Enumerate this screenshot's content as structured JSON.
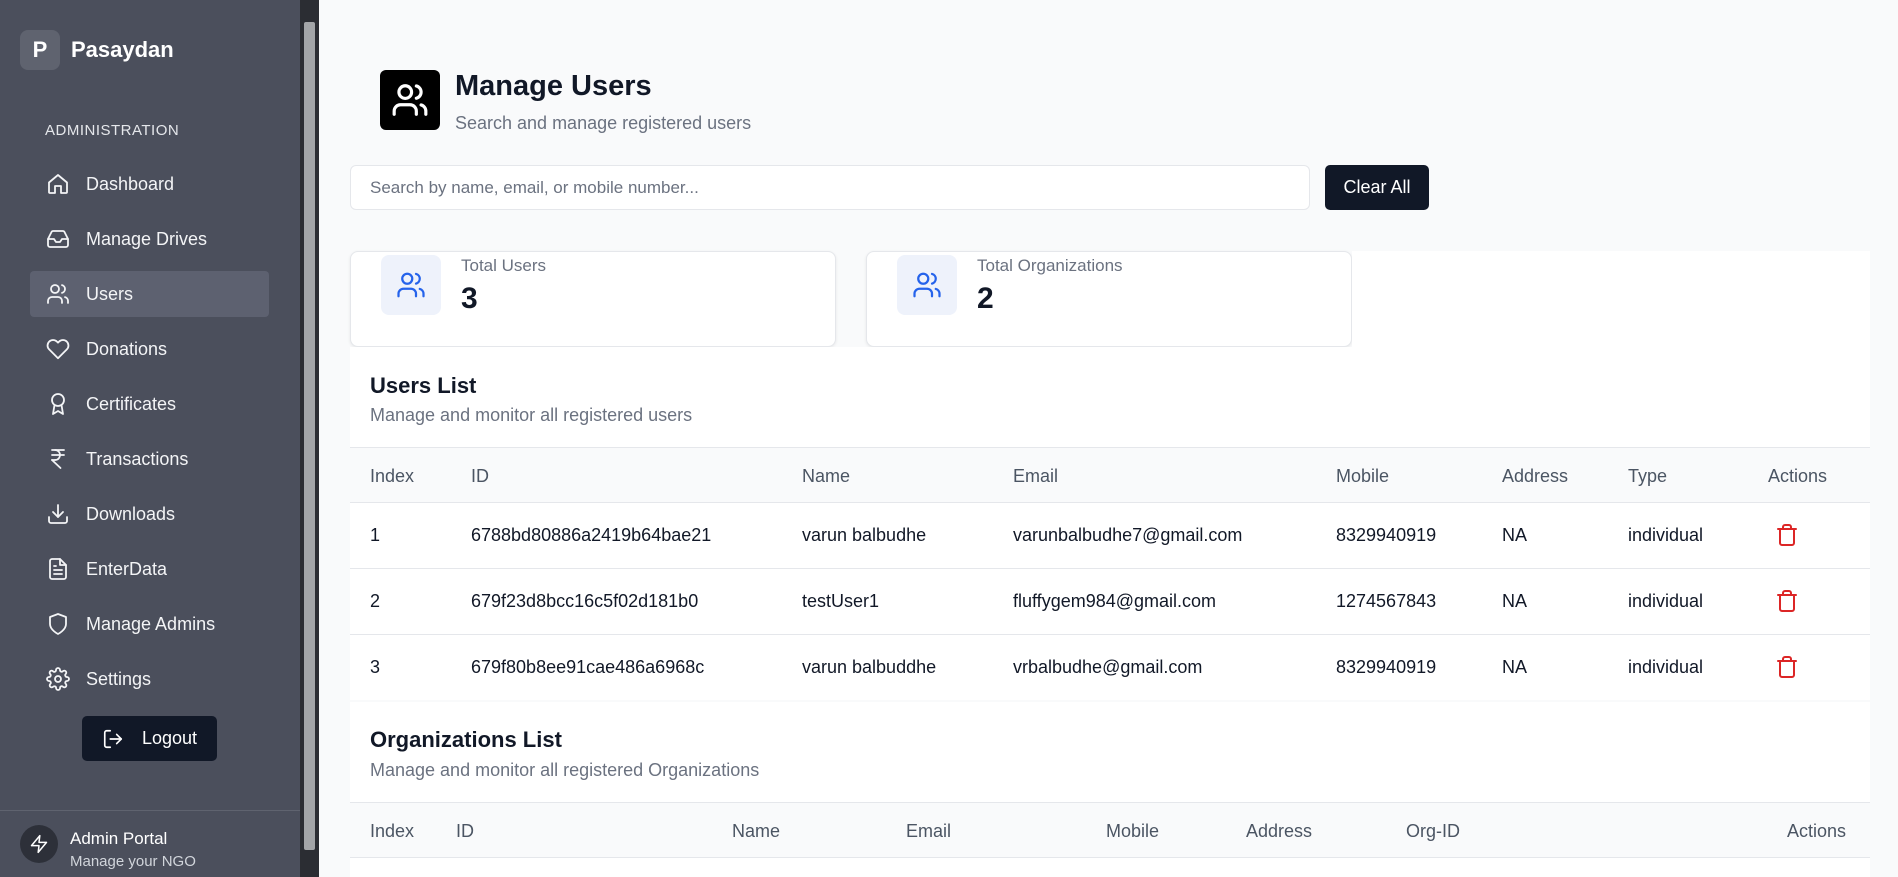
{
  "brand": {
    "logo_letter": "P",
    "name": "Pasaydan"
  },
  "sidebar": {
    "section_label": "ADMINISTRATION",
    "items": [
      {
        "label": "Dashboard",
        "icon": "home-icon"
      },
      {
        "label": "Manage Drives",
        "icon": "inbox-icon"
      },
      {
        "label": "Users",
        "icon": "users-icon",
        "active": true
      },
      {
        "label": "Donations",
        "icon": "heart-icon"
      },
      {
        "label": "Certificates",
        "icon": "award-icon"
      },
      {
        "label": "Transactions",
        "icon": "rupee-icon"
      },
      {
        "label": "Downloads",
        "icon": "download-icon"
      },
      {
        "label": "EnterData",
        "icon": "file-text-icon"
      },
      {
        "label": "Manage Admins",
        "icon": "shield-icon"
      },
      {
        "label": "Settings",
        "icon": "gear-icon"
      }
    ],
    "logout_label": "Logout",
    "footer": {
      "title": "Admin Portal",
      "subtitle": "Manage your NGO"
    }
  },
  "header": {
    "title": "Manage Users",
    "subtitle": "Search and manage registered users"
  },
  "search": {
    "placeholder": "Search by name, email, or mobile number...",
    "value": "",
    "clear_label": "Clear All"
  },
  "stats": [
    {
      "label": "Total Users",
      "value": "3"
    },
    {
      "label": "Total Organizations",
      "value": "2"
    }
  ],
  "users_list": {
    "title": "Users List",
    "subtitle": "Manage and monitor all registered users",
    "columns": [
      "Index",
      "ID",
      "Name",
      "Email",
      "Mobile",
      "Address",
      "Type",
      "Actions"
    ],
    "rows": [
      {
        "index": "1",
        "id": "6788bd80886a2419b64bae21",
        "name": "varun balbudhe",
        "email": "varunbalbudhe7@gmail.com",
        "mobile": "8329940919",
        "address": "NA",
        "type": "individual"
      },
      {
        "index": "2",
        "id": "679f23d8bcc16c5f02d181b0",
        "name": "testUser1",
        "email": "fluffygem984@gmail.com",
        "mobile": "1274567843",
        "address": "NA",
        "type": "individual"
      },
      {
        "index": "3",
        "id": "679f80b8ee91cae486a6968c",
        "name": "varun balbuddhe",
        "email": "vrbalbudhe@gmail.com",
        "mobile": "8329940919",
        "address": "NA",
        "type": "individual"
      }
    ]
  },
  "orgs_list": {
    "title": "Organizations List",
    "subtitle": "Manage and monitor all registered Organizations",
    "columns": [
      "Index",
      "ID",
      "Name",
      "Email",
      "Mobile",
      "Address",
      "Org-ID",
      "Actions"
    ]
  },
  "colors": {
    "sidebar_bg": "#4b4f5c",
    "primary_dark": "#111827",
    "accent_blue": "#2563eb",
    "danger_red": "#dc2626"
  }
}
